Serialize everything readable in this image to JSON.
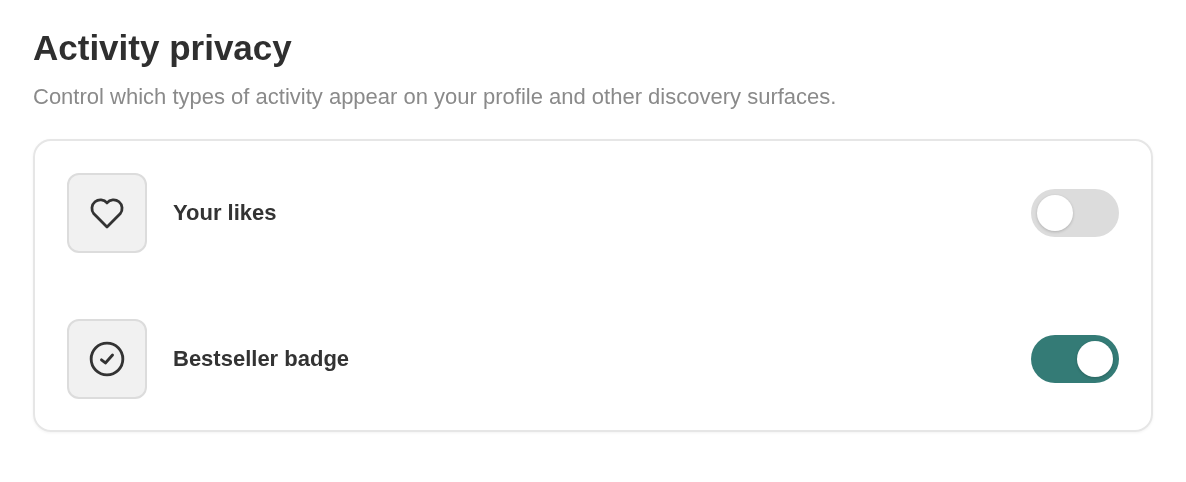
{
  "title": "Activity privacy",
  "description": "Control which types of activity appear on your profile and other discovery surfaces.",
  "settings": [
    {
      "kind": "heart",
      "label": "Your likes",
      "on": false
    },
    {
      "kind": "check-circle",
      "label": "Bestseller badge",
      "on": true
    }
  ]
}
